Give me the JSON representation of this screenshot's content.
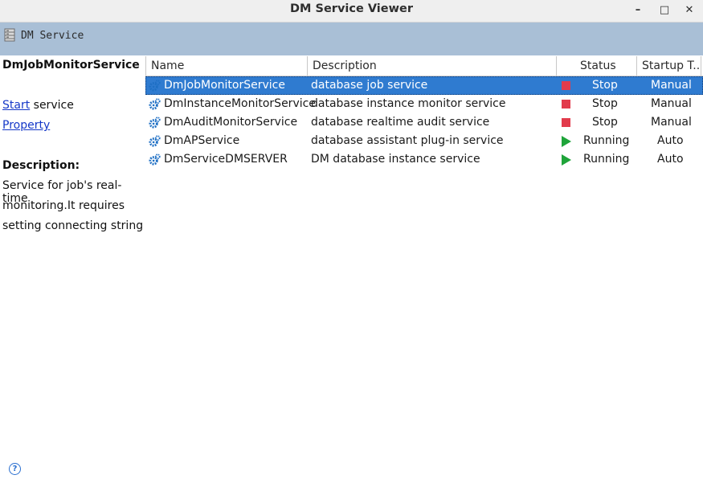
{
  "window": {
    "title": "DM Service Viewer"
  },
  "window_controls": {
    "minimize": "–",
    "maximize": "□",
    "close": "✕"
  },
  "toolbar": {
    "label": "DM Service"
  },
  "left_panel": {
    "selected_service": "DmJobMonitorService",
    "start_link": "Start",
    "start_suffix": " service",
    "property_link": "Property",
    "description_heading": "Description:",
    "description_lines": [
      "Service for job's real-time",
      "monitoring.It requires",
      "setting connecting string"
    ]
  },
  "table": {
    "columns": [
      "Name",
      "Description",
      "Status",
      "Startup T..."
    ],
    "rows": [
      {
        "name": "DmJobMonitorService",
        "description": "database job service",
        "status": "Stop",
        "status_icon": "stop-icon",
        "startup": "Manual",
        "selected": true
      },
      {
        "name": "DmInstanceMonitorService",
        "description": "database instance monitor service",
        "status": "Stop",
        "status_icon": "stop-icon",
        "startup": "Manual",
        "selected": false
      },
      {
        "name": "DmAuditMonitorService",
        "description": "database realtime audit service",
        "status": "Stop",
        "status_icon": "stop-icon",
        "startup": "Manual",
        "selected": false
      },
      {
        "name": "DmAPService",
        "description": "database assistant plug-in service",
        "status": "Running",
        "status_icon": "running-icon",
        "startup": "Auto",
        "selected": false
      },
      {
        "name": "DmServiceDMSERVER",
        "description": "DM database instance service",
        "status": "Running",
        "status_icon": "running-icon",
        "startup": "Auto",
        "selected": false
      }
    ]
  },
  "colors": {
    "toolbar_bg": "#a9bfd6",
    "selection": "#2f7bd0",
    "stop": "#e23b4c",
    "running": "#1fa43a",
    "link": "#1538c8"
  },
  "help": {
    "glyph": "?"
  }
}
